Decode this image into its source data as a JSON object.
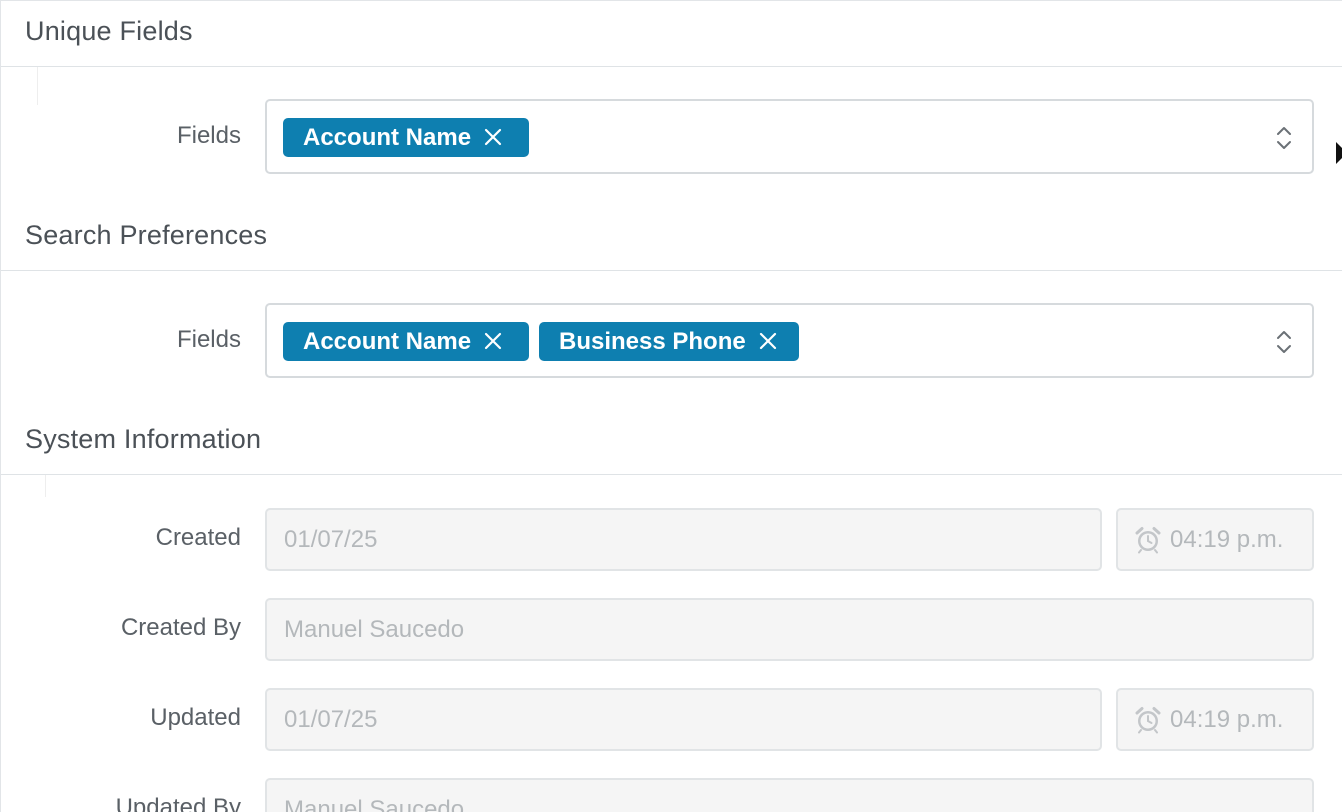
{
  "sections": {
    "unique_fields": {
      "title": "Unique Fields",
      "fields_label": "Fields",
      "chips": [
        "Account Name"
      ]
    },
    "search_preferences": {
      "title": "Search Preferences",
      "fields_label": "Fields",
      "chips": [
        "Account Name",
        "Business Phone"
      ]
    },
    "system_information": {
      "title": "System Information",
      "created_label": "Created",
      "created_date": "01/07/25",
      "created_time": "04:19 p.m.",
      "created_by_label": "Created By",
      "created_by": "Manuel Saucedo",
      "updated_label": "Updated",
      "updated_date": "01/07/25",
      "updated_time": "04:19 p.m.",
      "updated_by_label": "Updated By",
      "updated_by": "Manuel Saucedo"
    }
  },
  "colors": {
    "chip": "#0e7fb0",
    "readonly_bg": "#f5f5f5"
  },
  "icons": [
    "close-icon",
    "chevron-updown-icon",
    "alarm-clock-icon"
  ]
}
